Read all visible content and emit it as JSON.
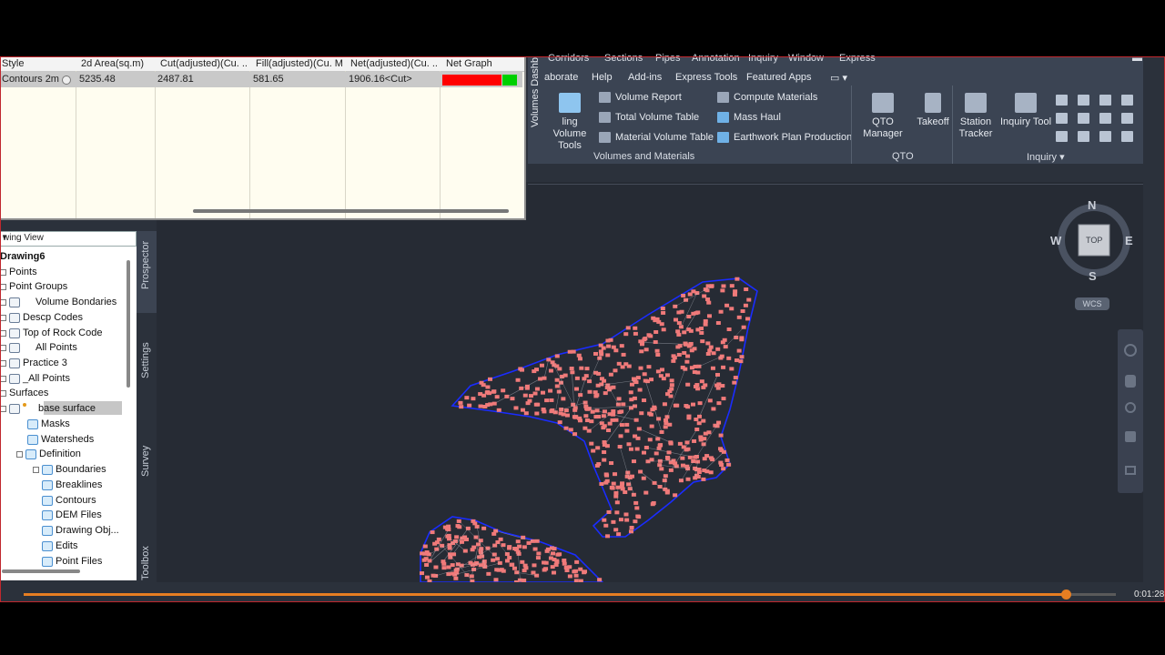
{
  "menu": {
    "items": [
      "Corridors",
      "Sections",
      "Pipes",
      "Annotation",
      "Inquiry",
      "Window",
      "Express"
    ]
  },
  "ribbon_tabs": [
    "aborate",
    "Help",
    "Add-ins",
    "Express Tools",
    "Featured Apps"
  ],
  "volumes_dashboard_tab": "Volumes Dashb",
  "volumes_panel": {
    "big_button": "ling Volume Tools",
    "col1": [
      "Volume Report",
      "Total Volume Table",
      "Material Volume Table"
    ],
    "col2": [
      "Compute Materials",
      "Mass Haul",
      "Earthwork Plan Production"
    ],
    "label": "Volumes and Materials"
  },
  "qto_panel": {
    "buttons": [
      "QTO Manager",
      "Takeoff"
    ],
    "label": "QTO"
  },
  "inquiry_panel": {
    "buttons": [
      "Station Tracker",
      "Inquiry Tool"
    ],
    "label": "Inquiry"
  },
  "volume_table": {
    "headers": [
      "Style",
      "2d Area(sq.m)",
      "Cut(adjusted)(Cu. ...",
      "Fill(adjusted)(Cu. M.)",
      "Net(adjusted)(Cu. ...",
      "Net Graph"
    ],
    "row": {
      "style": "Contours 2m...",
      "area": "5235.48",
      "cut": "2487.81",
      "fill": "581.65",
      "net": "1906.16<Cut>",
      "net_graph_cut_fraction": 0.79
    }
  },
  "prospector": {
    "view": "wing View",
    "tree": {
      "drawing": "Drawing6",
      "points": "Points",
      "point_groups": "Point Groups",
      "groups": [
        "Volume Bondaries",
        "Descp Codes",
        "Top of Rock Code",
        "All Points",
        "Practice 3",
        "_All Points"
      ],
      "surfaces": "Surfaces",
      "surface": "base surface",
      "surface_children": [
        "Masks",
        "Watersheds",
        "Definition"
      ],
      "definition_children": [
        "Boundaries",
        "Breaklines",
        "Contours",
        "DEM Files",
        "Drawing Obj...",
        "Edits",
        "Point Files"
      ]
    }
  },
  "side_tabs": [
    "Prospector",
    "Settings",
    "Survey",
    "Toolbox"
  ],
  "viewcube": {
    "north": "N",
    "south": "S",
    "east": "E",
    "west": "W",
    "face": "TOP",
    "ucs": "WCS"
  },
  "video": {
    "time": "0:01:28",
    "progress": 0.954
  },
  "colors": {
    "cut": "#ff0000",
    "fill": "#00d000",
    "points": "#f07a7a",
    "boundary": "#1a2cff",
    "progress": "#e67e22"
  }
}
